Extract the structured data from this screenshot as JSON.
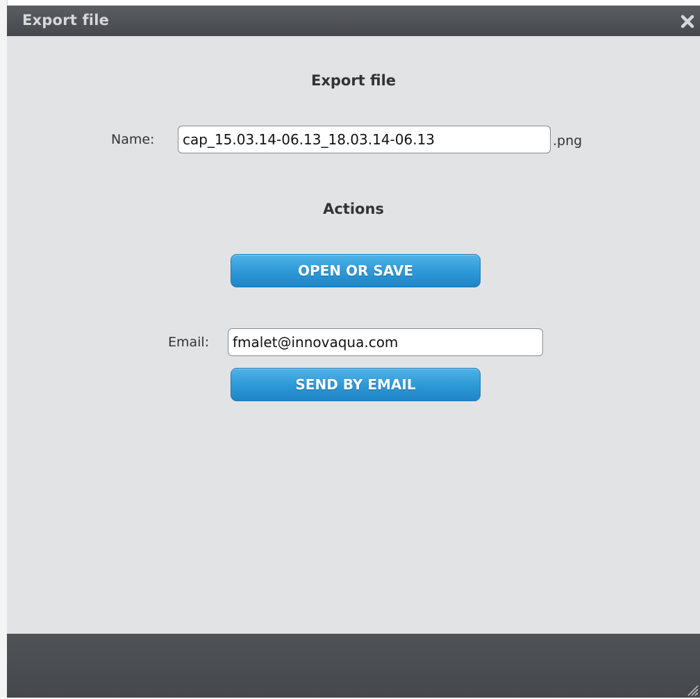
{
  "dialog": {
    "title": "Export file",
    "close_icon": "close-icon",
    "colors": {
      "titlebar": "#45484c",
      "body": "#e2e3e4",
      "button": "#2f9ad8"
    }
  },
  "export_section": {
    "heading": "Export file",
    "name_label": "Name:",
    "name_value": "cap_15.03.14-06.13_18.03.14-06.13",
    "extension": ".png"
  },
  "actions_section": {
    "heading": "Actions",
    "open_save_label": "OPEN OR SAVE",
    "email_label": "Email:",
    "email_value": "fmalet@innovaqua.com",
    "send_email_label": "SEND BY EMAIL"
  },
  "footer": {
    "resize_icon": "resize-grip-icon"
  }
}
